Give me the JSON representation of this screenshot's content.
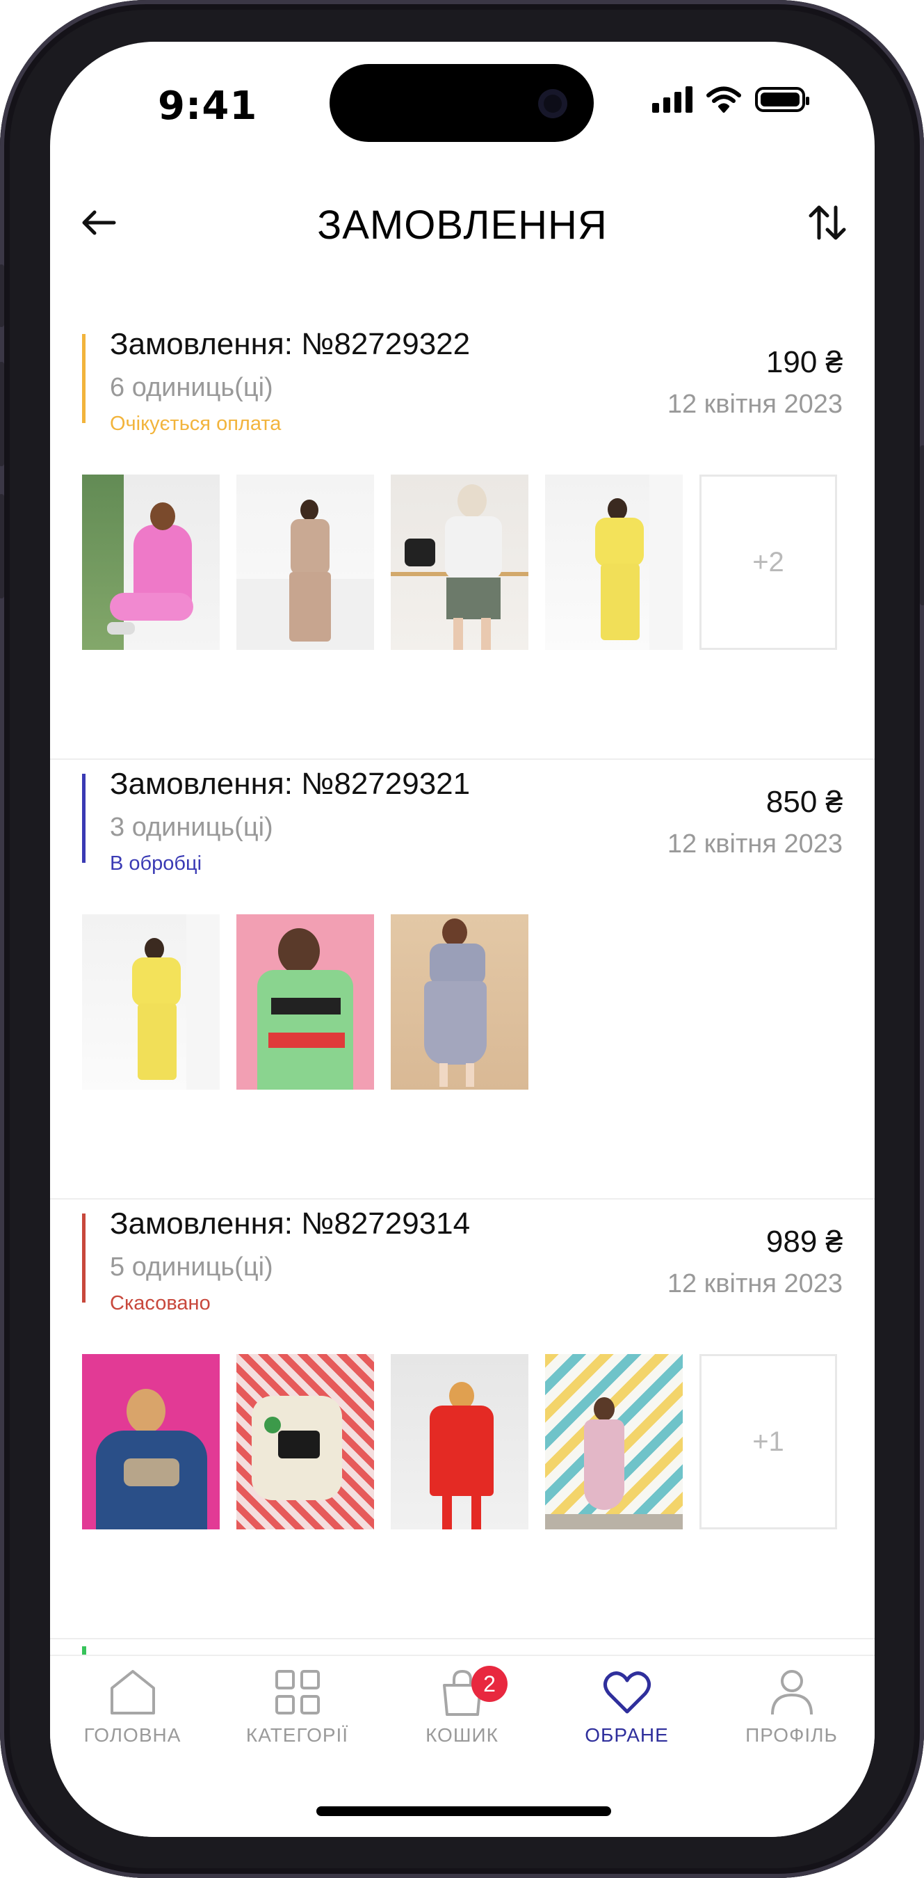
{
  "status_bar": {
    "time": "9:41"
  },
  "header": {
    "title": "ЗАМОВЛЕННЯ"
  },
  "colors": {
    "pending": "#f2b43c",
    "processing": "#3a3ab4",
    "cancelled": "#c8483c",
    "active_tab": "#2f2f9c",
    "badge": "#e8283f"
  },
  "orders": [
    {
      "title": "Замовлення: №82729322",
      "units": "6 одиниць(ці)",
      "status": "Очікується оплата",
      "price": "190 ₴",
      "date": "12 квітня 2023",
      "more": "+2"
    },
    {
      "title": "Замовлення: №82729321",
      "units": "3 одиниць(ці)",
      "status": "В обробці",
      "price": "850 ₴",
      "date": "12 квітня 2023"
    },
    {
      "title": "Замовлення: №82729314",
      "units": "5 одиниць(ці)",
      "status": "Скасовано",
      "price": "989 ₴",
      "date": "12 квітня 2023",
      "more": "+1"
    }
  ],
  "tabs": [
    {
      "label": "ГОЛОВНА",
      "icon": "home-icon"
    },
    {
      "label": "КАТЕГОРІЇ",
      "icon": "grid-icon"
    },
    {
      "label": "КОШИК",
      "icon": "bag-icon",
      "badge": "2"
    },
    {
      "label": "ОБРАНЕ",
      "icon": "heart-icon",
      "active": true
    },
    {
      "label": "ПРОФІЛЬ",
      "icon": "user-icon"
    }
  ]
}
